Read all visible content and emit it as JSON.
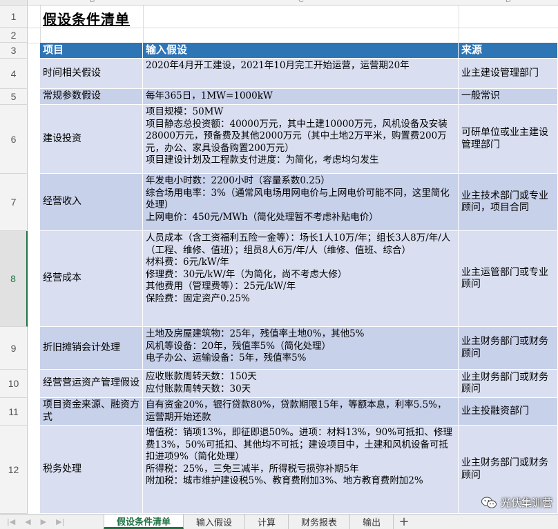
{
  "sheet": {
    "title": "假设条件清单",
    "columns": [
      "B",
      "C",
      "D"
    ],
    "rows": [
      "1",
      "2",
      "3",
      "4",
      "5",
      "6",
      "7",
      "8",
      "9",
      "10",
      "11",
      "12"
    ],
    "active_row": "8",
    "header": {
      "item": "项目",
      "input": "输入假设",
      "source": "来源"
    },
    "records": [
      {
        "item": "时间相关假设",
        "input": "2020年4月开工建设，2021年10月完工开始运营，运营期20年",
        "source": "业主建设管理部门"
      },
      {
        "item": "常规参数假设",
        "input": "每年365日，1MW=1000kW",
        "source": "一般常识"
      },
      {
        "item": "建设投资",
        "input": "项目规模：50MW\n项目静态总投资额：40000万元，其中土建10000万元，风机设备及安装28000万元，预备费及其他2000万元（其中土地2万平米，购置费200万元，办公、家具设备购置200万元）\n项目建设计划及工程款支付进度：为简化，考虑均匀发生",
        "source": "可研单位或业主建设管理部门"
      },
      {
        "item": "经营收入",
        "input": "年发电小时数：2200小时（容量系数0.25）\n综合场用电率：3%（通常风电场用网电价与上网电价可能不同，这里简化处理）\n上网电价：450元/MWh（简化处理暂不考虑补贴电价）",
        "source": "业主技术部门或专业顾问，项目合同"
      },
      {
        "item": "经营成本",
        "input": "人员成本（含工资福利五险一金等）：场长1人10万/年；组长3人8万/年/人（工程、维修、值班）；组员8人6万/年/人（维修、值班、综合）\n材料费：6元/kW/年\n修理费：30元/kW/年（为简化，尚不考虑大修）\n其他费用（管理费等）：25元/kW/年\n保险费：固定资产0.25%",
        "source": "业主运管部门或专业顾问"
      },
      {
        "item": "折旧摊销会计处理",
        "input": "土地及房屋建筑物：25年，残值率土地0%，其他5%\n风机等设备：20年，残值率5%（简化处理）\n电子办公、运输设备：5年，残值率5%",
        "source": "业主财务部门或财务顾问"
      },
      {
        "item": "经营营运资产管理假设",
        "input": "应收账款周转天数：150天\n应付账款周转天数：30天",
        "source": "业主财务部门或财务顾问"
      },
      {
        "item": "项目资金来源、融资方式",
        "input": "自有资金20%，银行贷款80%，贷款期限15年，等额本息，利率5.5%，运营期开始还款",
        "source": "业主投融资部门"
      },
      {
        "item": "税务处理",
        "input": "增值税：销项13%，即征即退50%。进项：材料13%，90%可抵扣、修理费13%，50%可抵扣、其他均不可抵；建设项目中，土建和风机设备可抵扣进项9%（简化处理）\n所得税：25%，三免三减半，所得税亏损弥补期5年\n附加税：城市维护建设税5%、教育费附加3%、地方教育费附加2%",
        "source": "业主财务部门或财务顾问"
      }
    ]
  },
  "watermark": {
    "text": "光伏集训营",
    "icon": "wechat-icon"
  },
  "tabs": {
    "items": [
      "假设条件清单",
      "输入假设",
      "计算",
      "财务报表",
      "输出"
    ],
    "active_index": 0,
    "add_icon": "plus-icon"
  },
  "colors": {
    "header_blue": "#2e75b6",
    "row_light": "#d9dff0",
    "row_dark": "#c8d1ea",
    "excel_green": "#217346"
  }
}
